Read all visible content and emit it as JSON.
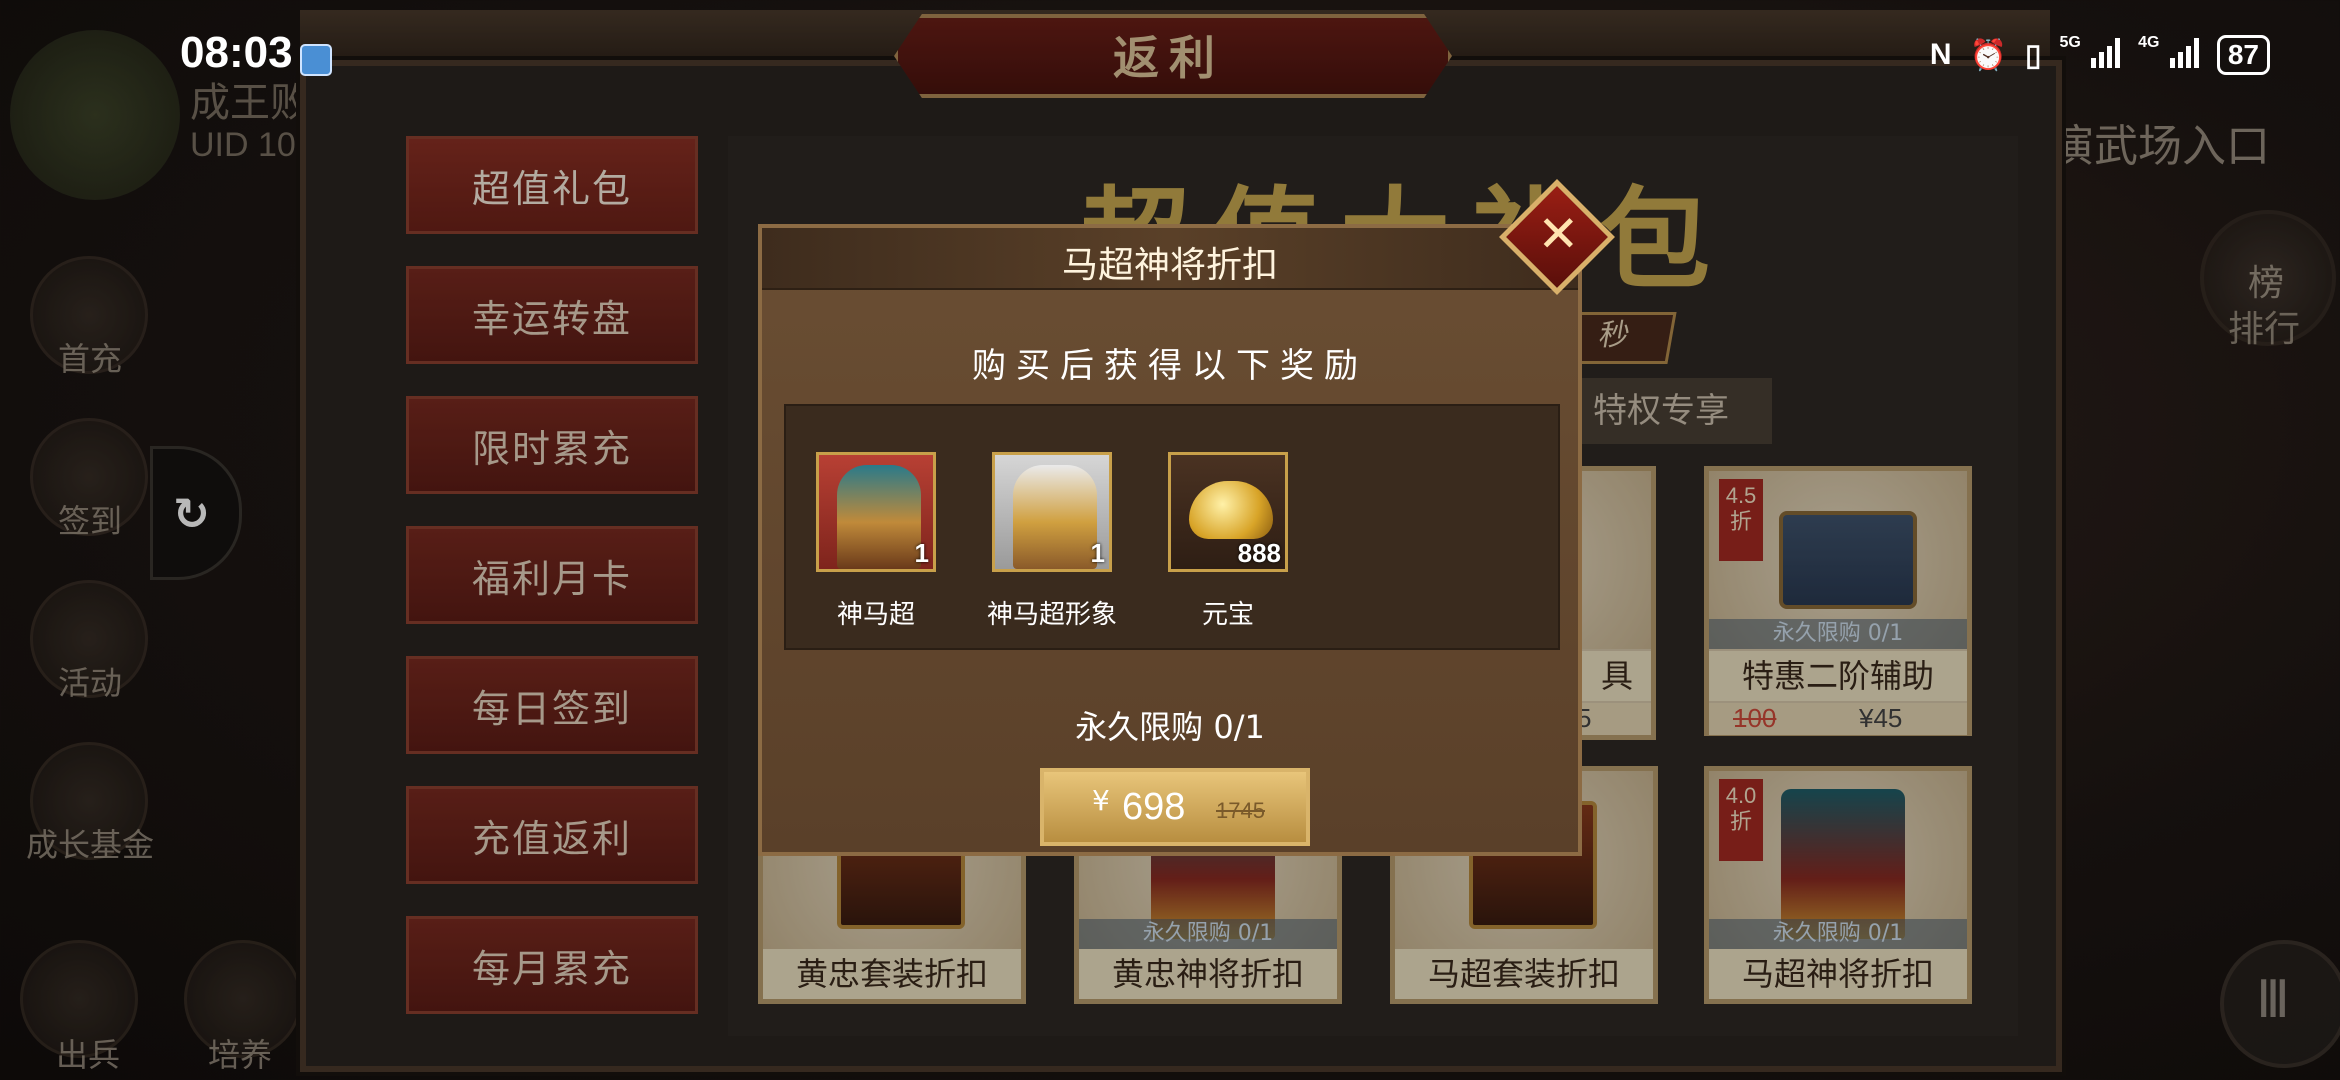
{
  "status_bar": {
    "time": "08:03",
    "net1": "5G",
    "net2": "4G",
    "battery": "87"
  },
  "background": {
    "player_name": "成王败",
    "player_uid": "UID 10",
    "left_buttons": [
      "首充",
      "签到",
      "活动",
      "成长基金",
      "出兵",
      "培养"
    ],
    "right_entry": "演武场入口",
    "rank_label": "排行",
    "rank_icon_text": "榜"
  },
  "panel": {
    "title": "返利",
    "side_menu": [
      "超值礼包",
      "幸运转盘",
      "限时累充",
      "福利月卡",
      "每日签到",
      "充值返利",
      "每月累充"
    ],
    "banner_title": "超值大礼包",
    "countdown_suffix": "秒",
    "tab_privilege": "特权专享",
    "cards": [
      {
        "name": "特惠二阶辅助",
        "limit": "永久限购 0/1",
        "discount": "4.5 折",
        "orig_price": "100",
        "sale_price": "¥45"
      },
      {
        "name": "黄忠套装折扣",
        "limit": "",
        "discount": ""
      },
      {
        "name": "黄忠神将折扣",
        "limit": "永久限购 0/1",
        "discount": ""
      },
      {
        "name": "马超套装折扣",
        "limit": "",
        "discount": ""
      },
      {
        "name": "马超神将折扣",
        "limit": "永久限购 0/1",
        "discount": "4.0 折"
      }
    ],
    "partial_card_name": "具",
    "partial_card_price": "5"
  },
  "modal": {
    "title": "马超神将折扣",
    "subtitle": "购买后获得以下奖励",
    "rewards": [
      {
        "name": "神马超",
        "count": "1",
        "icon": "hero-icon"
      },
      {
        "name": "神马超形象",
        "count": "1",
        "icon": "hero-skin-icon"
      },
      {
        "name": "元宝",
        "count": "888",
        "icon": "gold-ingot-icon"
      }
    ],
    "limit_text": "永久限购 0/1",
    "price_symbol": "¥",
    "price": "698",
    "original_price": "1745",
    "close_symbol": "✕"
  },
  "colors": {
    "panel_bg": "#2a2521",
    "menu_red": "#7a2a20",
    "modal_bg": "#6a4e33",
    "gold": "#d9b46a"
  }
}
